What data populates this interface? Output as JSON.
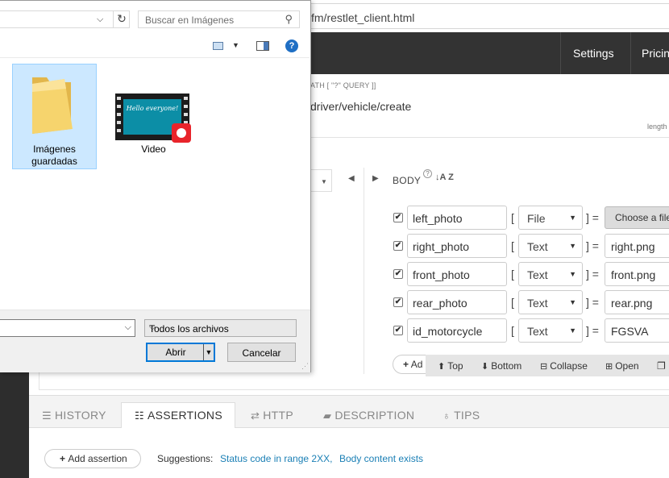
{
  "browser": {
    "url_fragment": "fm/restlet_client.html",
    "top_links": [
      "Settings",
      "Pricin"
    ],
    "path_hint": "ATH [ \"?\" QUERY ]]",
    "path_value": "driver/vehicle/create",
    "length_hint": "length",
    "method_tail": "n"
  },
  "body_section": {
    "label": "BODY",
    "sort_icon": "sort-az-icon",
    "params": [
      {
        "name": "left_photo",
        "type": "File",
        "value": "Choose a file",
        "is_file": true
      },
      {
        "name": "right_photo",
        "type": "Text",
        "value": "right.png",
        "is_file": false
      },
      {
        "name": "front_photo",
        "type": "Text",
        "value": "front.png",
        "is_file": false
      },
      {
        "name": "rear_photo",
        "type": "Text",
        "value": "rear.png",
        "is_file": false
      },
      {
        "name": "id_motorcycle",
        "type": "Text",
        "value": "FGSVA",
        "is_file": false
      }
    ],
    "add_label": "Ad",
    "toolbar": {
      "top": "Top",
      "bottom": "Bottom",
      "collapse": "Collapse",
      "open": "Open"
    }
  },
  "bottom_tabs": {
    "history": "HISTORY",
    "assertions": "ASSERTIONS",
    "http": "HTTP",
    "description": "DESCRIPTION",
    "tips": "TIPS",
    "active": "ASSERTIONS"
  },
  "assertions": {
    "add_button": "Add assertion",
    "suggestions_label": "Suggestions:",
    "suggestions": [
      "Status code in range 2XX,",
      "Body content exists"
    ]
  },
  "dialog": {
    "search_placeholder": "Buscar en Imágenes",
    "items": [
      {
        "label_line1": "Imágenes",
        "label_line2": "guardadas",
        "kind": "folder",
        "selected": true
      },
      {
        "label_line1": "Video",
        "kind": "video",
        "selected": false
      }
    ],
    "video_thumb_text": "Hello everyone!",
    "filter": "Todos los archivos",
    "open_button": "Abrir",
    "cancel_button": "Cancelar"
  },
  "colors": {
    "topbar": "#333333",
    "link": "#1a7fb5",
    "selection": "#cce8ff",
    "accent": "#0078d7"
  }
}
